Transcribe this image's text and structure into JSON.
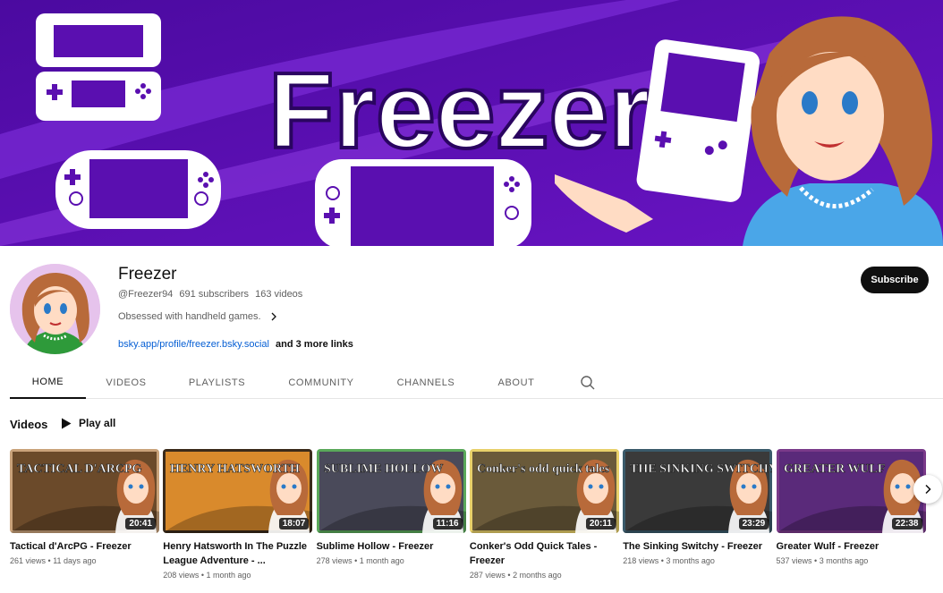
{
  "banner": {
    "title": "Freezer"
  },
  "channel": {
    "name": "Freezer",
    "handle": "@Freezer94",
    "subscribers": "691 subscribers",
    "video_count": "163 videos",
    "description": "Obsessed with handheld games.",
    "link": "bsky.app/profile/freezer.bsky.social",
    "more_links": "and 3 more links",
    "subscribe_label": "Subscribe"
  },
  "tabs": [
    {
      "label": "HOME",
      "active": true
    },
    {
      "label": "VIDEOS"
    },
    {
      "label": "PLAYLISTS"
    },
    {
      "label": "COMMUNITY"
    },
    {
      "label": "CHANNELS"
    },
    {
      "label": "ABOUT"
    }
  ],
  "section": {
    "title": "Videos",
    "play_all": "Play all"
  },
  "videos": [
    {
      "thumb_text": "TACTICAL D'ARCPG",
      "title": "Tactical d'ArcPG - Freezer",
      "duration": "20:41",
      "views": "261 views",
      "age": "11 days ago",
      "frame": "#c9a27a",
      "bg": "#6b4a2a"
    },
    {
      "thumb_text": "HENRY HATSWORTH",
      "title": "Henry Hatsworth In The Puzzle League Adventure - ...",
      "duration": "18:07",
      "views": "208 views",
      "age": "1 month ago",
      "frame": "#3a2a1a",
      "bg": "#d98a2c"
    },
    {
      "thumb_text": "SUBLIME HOLLOW",
      "title": "Sublime Hollow - Freezer",
      "duration": "11:16",
      "views": "278 views",
      "age": "1 month ago",
      "frame": "#5aa85a",
      "bg": "#4a4a5a"
    },
    {
      "thumb_text": "Conker's odd quick tales",
      "title": "Conker's Odd Quick Tales - Freezer",
      "duration": "20:11",
      "views": "287 views",
      "age": "2 months ago",
      "frame": "#e8d06a",
      "bg": "#6a5a3a"
    },
    {
      "thumb_text": "THE SINKING SWITCHY",
      "title": "The Sinking Switchy - Freezer",
      "duration": "23:29",
      "views": "218 views",
      "age": "3 months ago",
      "frame": "#3a5a6a",
      "bg": "#3a3a3a"
    },
    {
      "thumb_text": "GREATER WULF",
      "title": "Greater Wulf - Freezer",
      "duration": "22:38",
      "views": "537 views",
      "age": "3 months ago",
      "frame": "#7a3a8a",
      "bg": "#5a2a7a"
    }
  ],
  "icons": {
    "search": "search-icon",
    "play": "play-icon",
    "next": "chevron-right-icon",
    "desc_more": "chevron-right-icon"
  },
  "colors": {
    "banner_bg": "#5a0fb0",
    "link": "#065fd4",
    "subscribe_bg": "#0f0f0f"
  }
}
